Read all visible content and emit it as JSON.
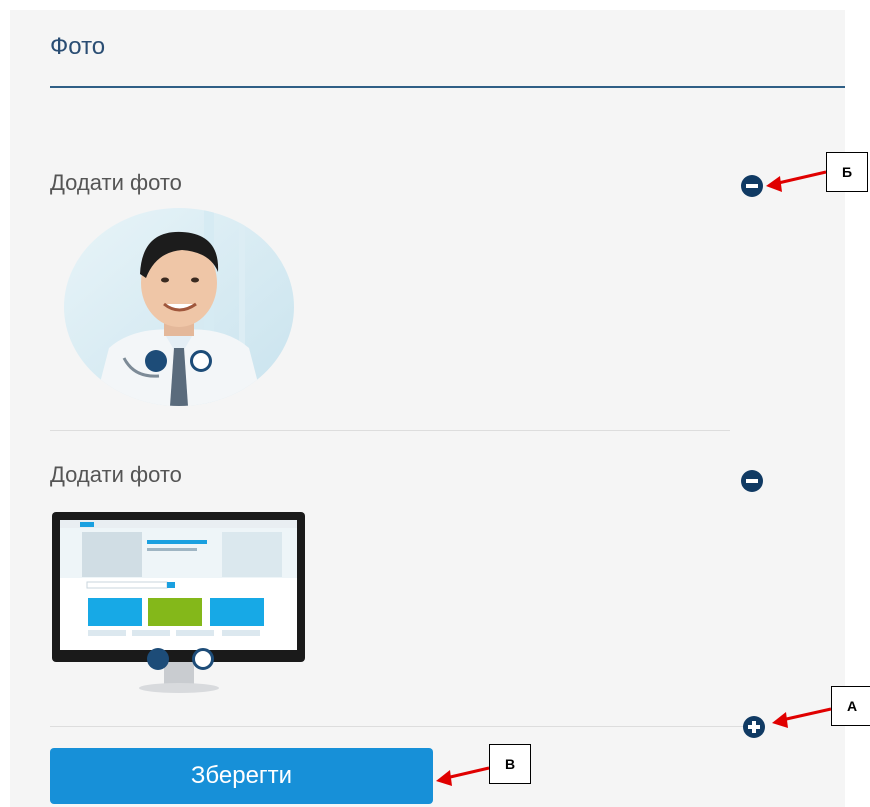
{
  "section": {
    "title": "Фото"
  },
  "photo_blocks": [
    {
      "label": "Додати фото",
      "photo": "portrait-photo"
    },
    {
      "label": "Додати фото",
      "photo": "monitor-website-preview"
    }
  ],
  "actions": {
    "save_label": "Зберегти"
  },
  "annotations": [
    {
      "letter": "Б",
      "target": "remove-photo-block-button"
    },
    {
      "letter": "А",
      "target": "add-photo-block-button"
    },
    {
      "letter": "В",
      "target": "save-button"
    }
  ],
  "colors": {
    "accent": "#1790d8",
    "icon": "#103a63",
    "title": "#2a4d73",
    "annotation_arrow": "#e00000"
  }
}
